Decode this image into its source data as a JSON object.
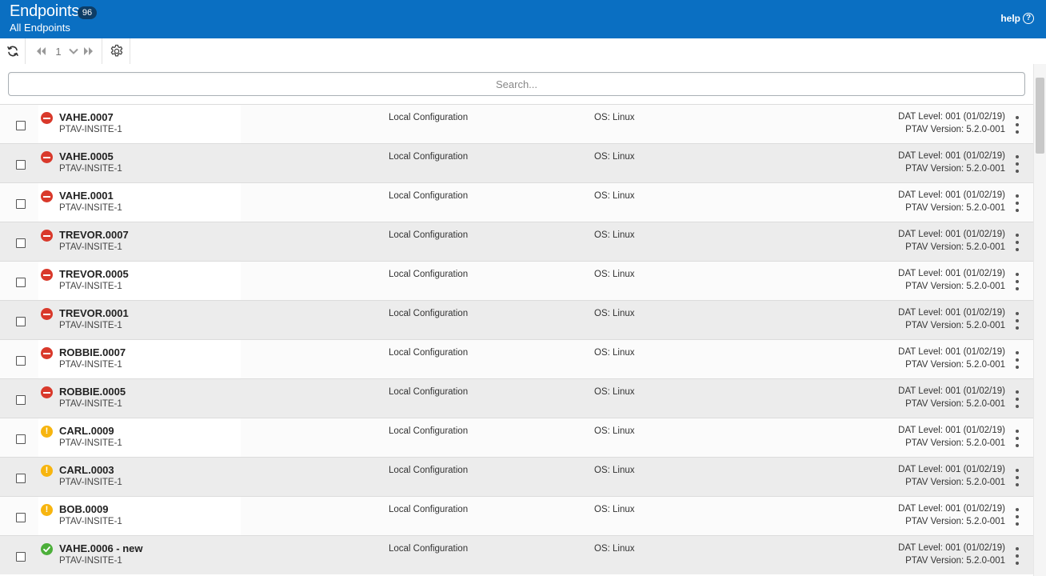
{
  "header": {
    "title": "Endpoints",
    "count": "96",
    "subtitle": "All Endpoints",
    "help_label": "help",
    "help_icon_glyph": "?",
    "brand_color": "#0a6fc2"
  },
  "toolbar": {
    "refresh_icon": "refresh-icon",
    "page_first_icon": "double-chevron-left-icon",
    "page_number": "1",
    "page_dropdown_icon": "chevron-down-icon",
    "page_last_icon": "double-chevron-right-icon",
    "settings_icon": "gear-icon"
  },
  "search": {
    "placeholder": "Search...",
    "value": ""
  },
  "endpoints": [
    {
      "name": "VAHE.0007",
      "host": "PTAV-INSITE-1",
      "status": "error",
      "policy": "Local Configuration",
      "os": "OS: Linux",
      "dat": "DAT Level: 001 (01/02/19)",
      "version": "PTAV Version: 5.2.0-001"
    },
    {
      "name": "VAHE.0005",
      "host": "PTAV-INSITE-1",
      "status": "error",
      "policy": "Local Configuration",
      "os": "OS: Linux",
      "dat": "DAT Level: 001 (01/02/19)",
      "version": "PTAV Version: 5.2.0-001"
    },
    {
      "name": "VAHE.0001",
      "host": "PTAV-INSITE-1",
      "status": "error",
      "policy": "Local Configuration",
      "os": "OS: Linux",
      "dat": "DAT Level: 001 (01/02/19)",
      "version": "PTAV Version: 5.2.0-001"
    },
    {
      "name": "TREVOR.0007",
      "host": "PTAV-INSITE-1",
      "status": "error",
      "policy": "Local Configuration",
      "os": "OS: Linux",
      "dat": "DAT Level: 001 (01/02/19)",
      "version": "PTAV Version: 5.2.0-001"
    },
    {
      "name": "TREVOR.0005",
      "host": "PTAV-INSITE-1",
      "status": "error",
      "policy": "Local Configuration",
      "os": "OS: Linux",
      "dat": "DAT Level: 001 (01/02/19)",
      "version": "PTAV Version: 5.2.0-001"
    },
    {
      "name": "TREVOR.0001",
      "host": "PTAV-INSITE-1",
      "status": "error",
      "policy": "Local Configuration",
      "os": "OS: Linux",
      "dat": "DAT Level: 001 (01/02/19)",
      "version": "PTAV Version: 5.2.0-001"
    },
    {
      "name": "ROBBIE.0007",
      "host": "PTAV-INSITE-1",
      "status": "error",
      "policy": "Local Configuration",
      "os": "OS: Linux",
      "dat": "DAT Level: 001 (01/02/19)",
      "version": "PTAV Version: 5.2.0-001"
    },
    {
      "name": "ROBBIE.0005",
      "host": "PTAV-INSITE-1",
      "status": "error",
      "policy": "Local Configuration",
      "os": "OS: Linux",
      "dat": "DAT Level: 001 (01/02/19)",
      "version": "PTAV Version: 5.2.0-001"
    },
    {
      "name": "CARL.0009",
      "host": "PTAV-INSITE-1",
      "status": "warning",
      "policy": "Local Configuration",
      "os": "OS: Linux",
      "dat": "DAT Level: 001 (01/02/19)",
      "version": "PTAV Version: 5.2.0-001"
    },
    {
      "name": "CARL.0003",
      "host": "PTAV-INSITE-1",
      "status": "warning",
      "policy": "Local Configuration",
      "os": "OS: Linux",
      "dat": "DAT Level: 001 (01/02/19)",
      "version": "PTAV Version: 5.2.0-001"
    },
    {
      "name": "BOB.0009",
      "host": "PTAV-INSITE-1",
      "status": "warning",
      "policy": "Local Configuration",
      "os": "OS: Linux",
      "dat": "DAT Level: 001 (01/02/19)",
      "version": "PTAV Version: 5.2.0-001"
    },
    {
      "name": "VAHE.0006 - new",
      "host": "PTAV-INSITE-1",
      "status": "ok",
      "policy": "Local Configuration",
      "os": "OS: Linux",
      "dat": "DAT Level: 001 (01/02/19)",
      "version": "PTAV Version: 5.2.0-001"
    }
  ],
  "status_icons": {
    "error": "error-minus-icon",
    "warning": "warning-exclamation-icon",
    "ok": "check-circle-icon",
    "warning_glyph": "!"
  },
  "colors": {
    "error": "#d9392b",
    "warning": "#f7b50f",
    "ok": "#4caf3a"
  }
}
